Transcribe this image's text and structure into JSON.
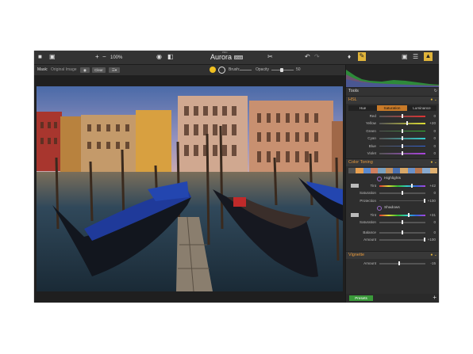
{
  "app": {
    "title_small": "PRO",
    "title": "Aurora",
    "badge": "2018"
  },
  "toolbar": {
    "zoom": "100%",
    "plus": "+",
    "minus": "−"
  },
  "options": {
    "mask_label": "Mask:",
    "mask_value": "Original Image",
    "clear": "Clear",
    "brush_label": "Brush:",
    "opacity_label": "Opacity",
    "opacity_value": "50"
  },
  "panel": {
    "tools_title": "Tools",
    "hsl_title": "HSL",
    "hsl_tabs": [
      "Hue",
      "Saturation",
      "Luminance"
    ],
    "hsl_rows": [
      {
        "label": "Red",
        "value": "0",
        "fill": 0.5
      },
      {
        "label": "Yellow",
        "value": "+20",
        "fill": 0.6
      },
      {
        "label": "Green",
        "value": "0",
        "fill": 0.5
      },
      {
        "label": "Cyan",
        "value": "0",
        "fill": 0.5
      },
      {
        "label": "Blue",
        "value": "0",
        "fill": 0.5
      },
      {
        "label": "Violet",
        "value": "0",
        "fill": 0.5
      }
    ],
    "toning_title": "Color Toning",
    "highlights_title": "Highlights",
    "highlights_rows": [
      {
        "label": "Tint",
        "value": "+42",
        "fill": 0.71
      },
      {
        "label": "Saturation",
        "value": "0",
        "fill": 0.5
      },
      {
        "label": "Protection",
        "value": "+100",
        "fill": 1
      }
    ],
    "shadows_title": "Shadows",
    "shadows_rows": [
      {
        "label": "Tint",
        "value": "+31",
        "fill": 0.65
      },
      {
        "label": "Saturation",
        "value": "0",
        "fill": 0.5
      }
    ],
    "balance_rows": [
      {
        "label": "Balance",
        "value": "0",
        "fill": 0.5
      },
      {
        "label": "Amount",
        "value": "+100",
        "fill": 1
      }
    ],
    "vignette_title": "Vignette",
    "vignette_rows": [
      {
        "label": "Amount",
        "value": "-15",
        "fill": 0.42
      }
    ],
    "presets": "Presets",
    "plus": "+"
  },
  "colors": {
    "accent": "#e89a3c",
    "green": "#4caf50"
  }
}
